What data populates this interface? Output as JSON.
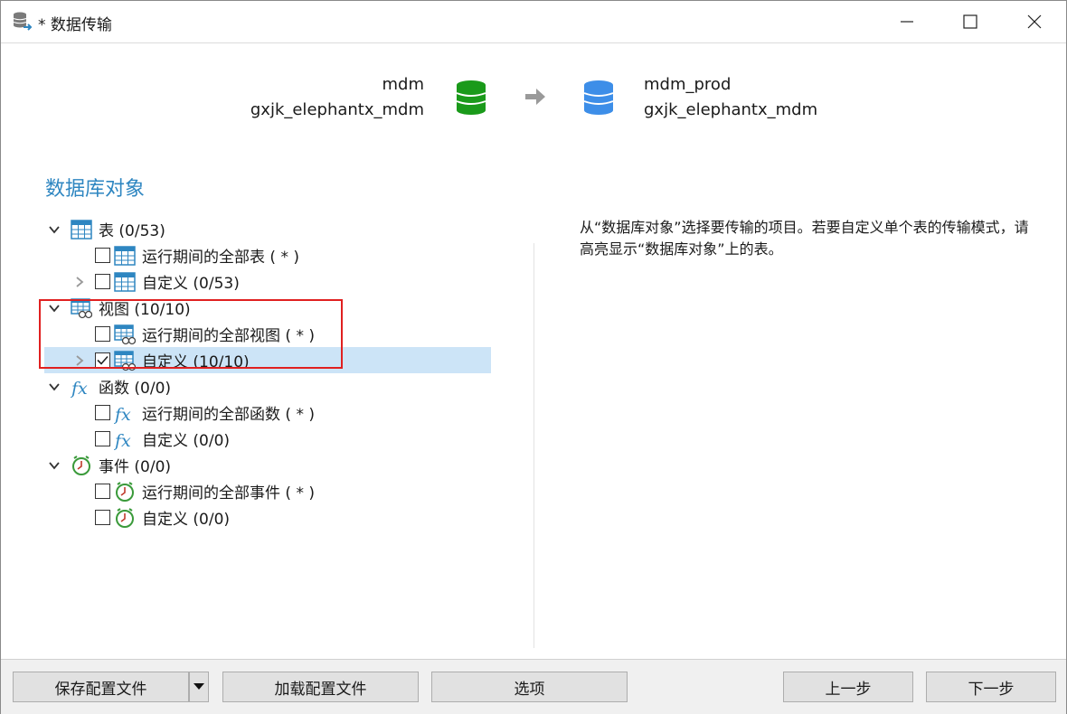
{
  "window": {
    "title": "* 数据传输"
  },
  "header": {
    "source": {
      "connection": "mdm",
      "database": "gxjk_elephantx_mdm",
      "icon": "database-green-icon",
      "color": "#1a9a1a"
    },
    "target": {
      "connection": "mdm_prod",
      "database": "gxjk_elephantx_mdm",
      "icon": "database-blue-icon",
      "color": "#3d8ee8"
    },
    "arrow_icon": "arrow-right-icon"
  },
  "section": {
    "title": "数据库对象"
  },
  "description": "从“数据库对象”选择要传输的项目。若要自定义单个表的传输模式，请高亮显示“数据库对象”上的表。",
  "tree": {
    "tables": {
      "label": "表 (0/53)",
      "expanded": true,
      "children": [
        {
          "label": "运行期间的全部表 ( * )",
          "checked": false
        },
        {
          "label": "自定义 (0/53)",
          "checked": false,
          "expandable": true
        }
      ]
    },
    "views": {
      "label": "视图 (10/10)",
      "expanded": true,
      "children": [
        {
          "label": "运行期间的全部视图 ( * )",
          "checked": false
        },
        {
          "label": "自定义 (10/10)",
          "checked": true,
          "expandable": true,
          "selected": true
        }
      ]
    },
    "functions": {
      "label": "函数 (0/0)",
      "expanded": true,
      "children": [
        {
          "label": "运行期间的全部函数 ( * )",
          "checked": false
        },
        {
          "label": "自定义 (0/0)",
          "checked": false
        }
      ]
    },
    "events": {
      "label": "事件 (0/0)",
      "expanded": true,
      "children": [
        {
          "label": "运行期间的全部事件 ( * )",
          "checked": false
        },
        {
          "label": "自定义 (0/0)",
          "checked": false
        }
      ]
    }
  },
  "footer": {
    "save_profile": "保存配置文件",
    "load_profile": "加载配置文件",
    "options": "选项",
    "back": "上一步",
    "next": "下一步"
  },
  "colors": {
    "accent": "#2e86c1",
    "selection": "#cce4f7",
    "highlight_box": "#e02020"
  }
}
